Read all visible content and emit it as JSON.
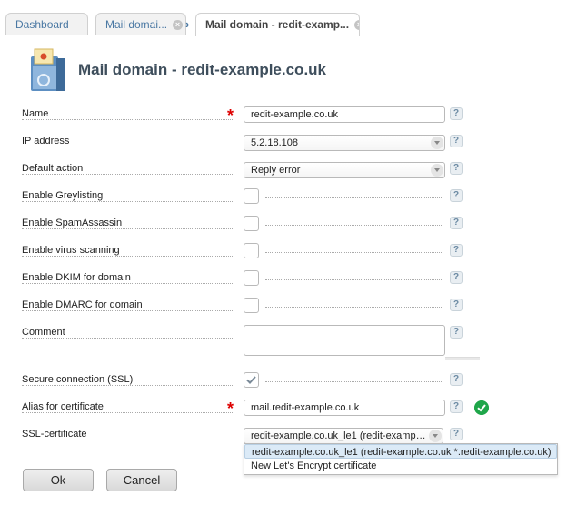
{
  "tabs": [
    {
      "label": "Dashboard"
    },
    {
      "label": "Mail domai...",
      "close": "×"
    },
    {
      "label": "Mail domain - redit-examp...",
      "close": "×"
    }
  ],
  "tab_separator": "›",
  "page": {
    "title": "Mail domain - redit-example.co.uk",
    "icon": "mail-domain-icon"
  },
  "form": {
    "required_mark": "*",
    "help_glyph": "?",
    "name": {
      "label": "Name",
      "value": "redit-example.co.uk"
    },
    "ip_address": {
      "label": "IP address",
      "value": "5.2.18.108"
    },
    "default_action": {
      "label": "Default action",
      "value": "Reply error"
    },
    "greylisting": {
      "label": "Enable Greylisting",
      "checked": false
    },
    "spamassassin": {
      "label": "Enable SpamAssassin",
      "checked": false
    },
    "virus_scanning": {
      "label": "Enable virus scanning",
      "checked": false
    },
    "dkim": {
      "label": "Enable DKIM for domain",
      "checked": false
    },
    "dmarc": {
      "label": "Enable DMARC for domain",
      "checked": false
    },
    "comment": {
      "label": "Comment",
      "value": ""
    },
    "ssl": {
      "label": "Secure connection (SSL)",
      "checked": true
    },
    "alias": {
      "label": "Alias for certificate",
      "value": "mail.redit-example.co.uk"
    },
    "ssl_certificate": {
      "label": "SSL-certificate",
      "value": "redit-example.co.uk_le1 (redit-example.co.uk *.redit-example.co.uk)",
      "options": [
        "redit-example.co.uk_le1 (redit-example.co.uk *.redit-example.co.uk)",
        "New Let's Encrypt certificate"
      ]
    }
  },
  "buttons": {
    "ok": "Ok",
    "cancel": "Cancel"
  },
  "colors": {
    "accent": "#4a78a3",
    "required": "#dd0000",
    "valid": "#1fa64a",
    "title": "#3e4e5c"
  }
}
